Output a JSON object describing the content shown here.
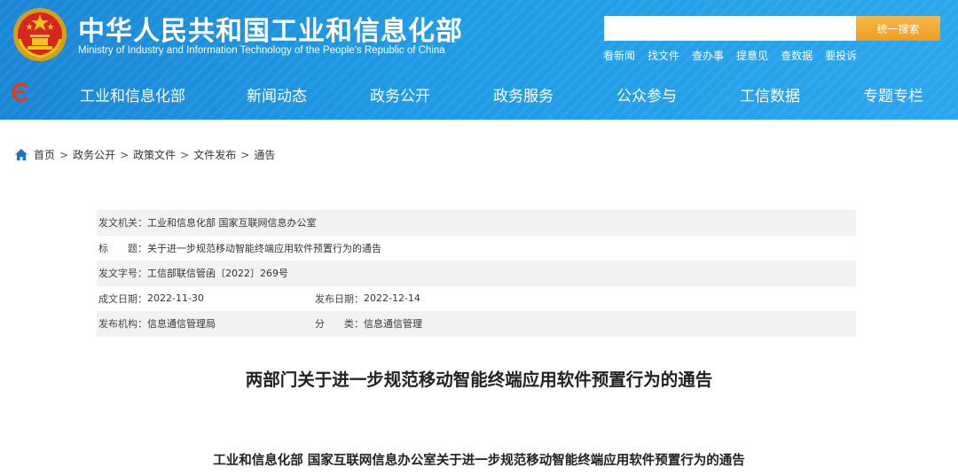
{
  "header": {
    "title_cn": "中华人民共和国工业和信息化部",
    "title_en": "Ministry of Industry and Information Technology of the People's Republic of China",
    "search": {
      "placeholder": "",
      "button_label": "统一搜索"
    },
    "quick_links": [
      "看新闻",
      "找文件",
      "查办事",
      "提意见",
      "查数据",
      "要投诉"
    ],
    "nav": [
      "工业和信息化部",
      "新闻动态",
      "政务公开",
      "政务服务",
      "公众参与",
      "工信数据",
      "专题专栏"
    ]
  },
  "breadcrumb": [
    "首页",
    "政务公开",
    "政策文件",
    "文件发布",
    "通告"
  ],
  "meta": {
    "issuer_label": "发文机关：",
    "issuer": "工业和信息化部 国家互联网信息办公室",
    "title_label": "标　　题：",
    "title": "关于进一步规范移动智能终端应用软件预置行为的通告",
    "doc_no_label": "发文字号：",
    "doc_no": "工信部联信管函〔2022〕269号",
    "created_label": "成文日期：",
    "created": "2022-11-30",
    "published_label": "发布日期：",
    "published": "2022-12-14",
    "org_label": "发布机构：",
    "org": "信息通信管理局",
    "category_label": "分　　类：",
    "category": "信息通信管理"
  },
  "document": {
    "title": "两部门关于进一步规范移动智能终端应用软件预置行为的通告",
    "subtitle": "工业和信息化部 国家互联网信息办公室关于进一步规范移动智能终端应用软件预置行为的通告"
  },
  "colors": {
    "header_blue": "#1f9be6",
    "search_button": "#f19b21",
    "meta_shade": "#f2f2f2",
    "nav_logo_red": "#e8380d"
  },
  "icons": [
    "national-emblem-icon",
    "miit-logo-icon",
    "home-icon"
  ]
}
